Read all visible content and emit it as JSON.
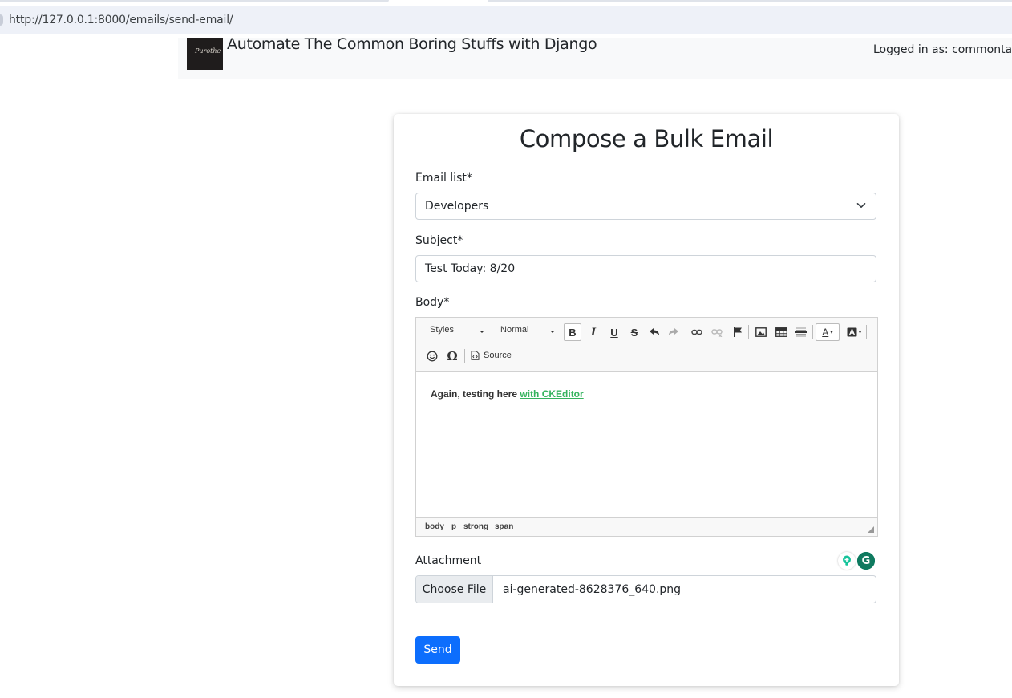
{
  "browser": {
    "url": "http://127.0.0.1:8000/emails/send-email/"
  },
  "navbar": {
    "logo_text": "Purothe",
    "brand": "Automate The Common Boring Stuffs with Django",
    "logged_in": "Logged in as: commontask_"
  },
  "form": {
    "title": "Compose a Bulk Email",
    "email_list_label": "Email list*",
    "email_list_value": "Developers",
    "subject_label": "Subject*",
    "subject_value": "Test Today: 8/20",
    "body_label": "Body*",
    "attachment_label": "Attachment",
    "choose_file_label": "Choose File",
    "file_name": "ai-generated-8628376_640.png",
    "send_label": "Send"
  },
  "editor": {
    "styles_label": "Styles",
    "format_label": "Normal",
    "source_label": "Source",
    "content_plain": "Again, testing here ",
    "content_link": "with CKEditor",
    "link_color": "#35b35e",
    "path": [
      "body",
      "p",
      "strong",
      "span"
    ],
    "toolbar_icons": [
      "bold-icon",
      "italic-icon",
      "underline-icon",
      "strikethrough-icon",
      "undo-icon",
      "redo-icon",
      "link-icon",
      "unlink-icon",
      "anchor-flag-icon",
      "image-icon",
      "table-icon",
      "horizontal-line-icon",
      "text-color-icon",
      "background-color-icon",
      "smiley-icon",
      "special-char-icon",
      "source-icon"
    ]
  },
  "colors": {
    "primary": "#0d6efd",
    "navbar_bg": "#f8f9fa",
    "grammarly": "#11795f"
  }
}
